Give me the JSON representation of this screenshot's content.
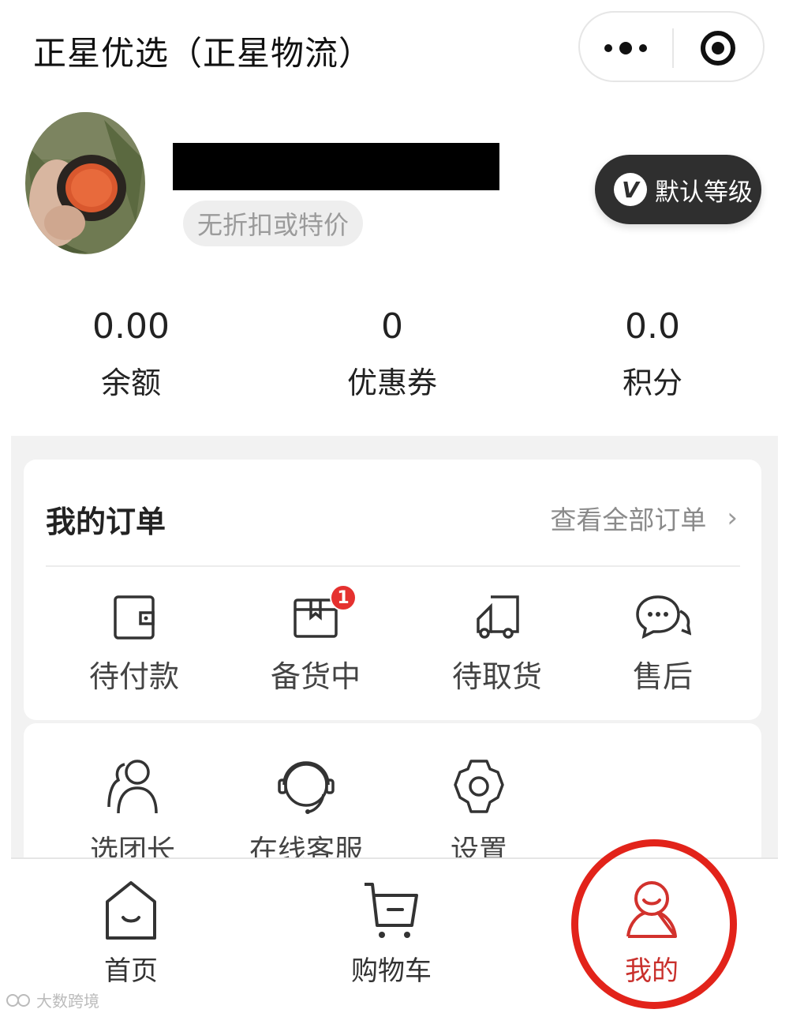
{
  "header": {
    "title": "正星优选（正星物流）",
    "more_icon": "more-dots-icon",
    "close_icon": "target-close-icon"
  },
  "profile": {
    "avatar_icon": "avatar-photo",
    "discount": "无折扣或特价",
    "level_badge": "V",
    "level_label": "默认等级"
  },
  "stats": [
    {
      "value": "0.00",
      "label": "余额"
    },
    {
      "value": "0",
      "label": "优惠券"
    },
    {
      "value": "0.0",
      "label": "积分"
    }
  ],
  "orders": {
    "title": "我的订单",
    "view_all": "查看全部订单",
    "chevron": "›",
    "items": [
      {
        "label": "待付款",
        "icon": "wallet-icon"
      },
      {
        "label": "备货中",
        "icon": "package-icon",
        "badge": "1"
      },
      {
        "label": "待取货",
        "icon": "truck-icon"
      },
      {
        "label": "售后",
        "icon": "chat-icon"
      }
    ]
  },
  "tools": {
    "items": [
      {
        "label": "选团长",
        "icon": "users-icon"
      },
      {
        "label": "在线客服",
        "icon": "headset-icon"
      },
      {
        "label": "设置",
        "icon": "gear-icon"
      }
    ]
  },
  "tabbar": {
    "items": [
      {
        "label": "首页",
        "icon": "home-icon"
      },
      {
        "label": "购物车",
        "icon": "cart-icon"
      },
      {
        "label": "我的",
        "icon": "user-icon",
        "active": true
      }
    ]
  },
  "colors": {
    "accent": "#e2231a",
    "badge": "#e5312f",
    "level_bg": "#2f2f2f"
  },
  "watermark": "大数跨境"
}
